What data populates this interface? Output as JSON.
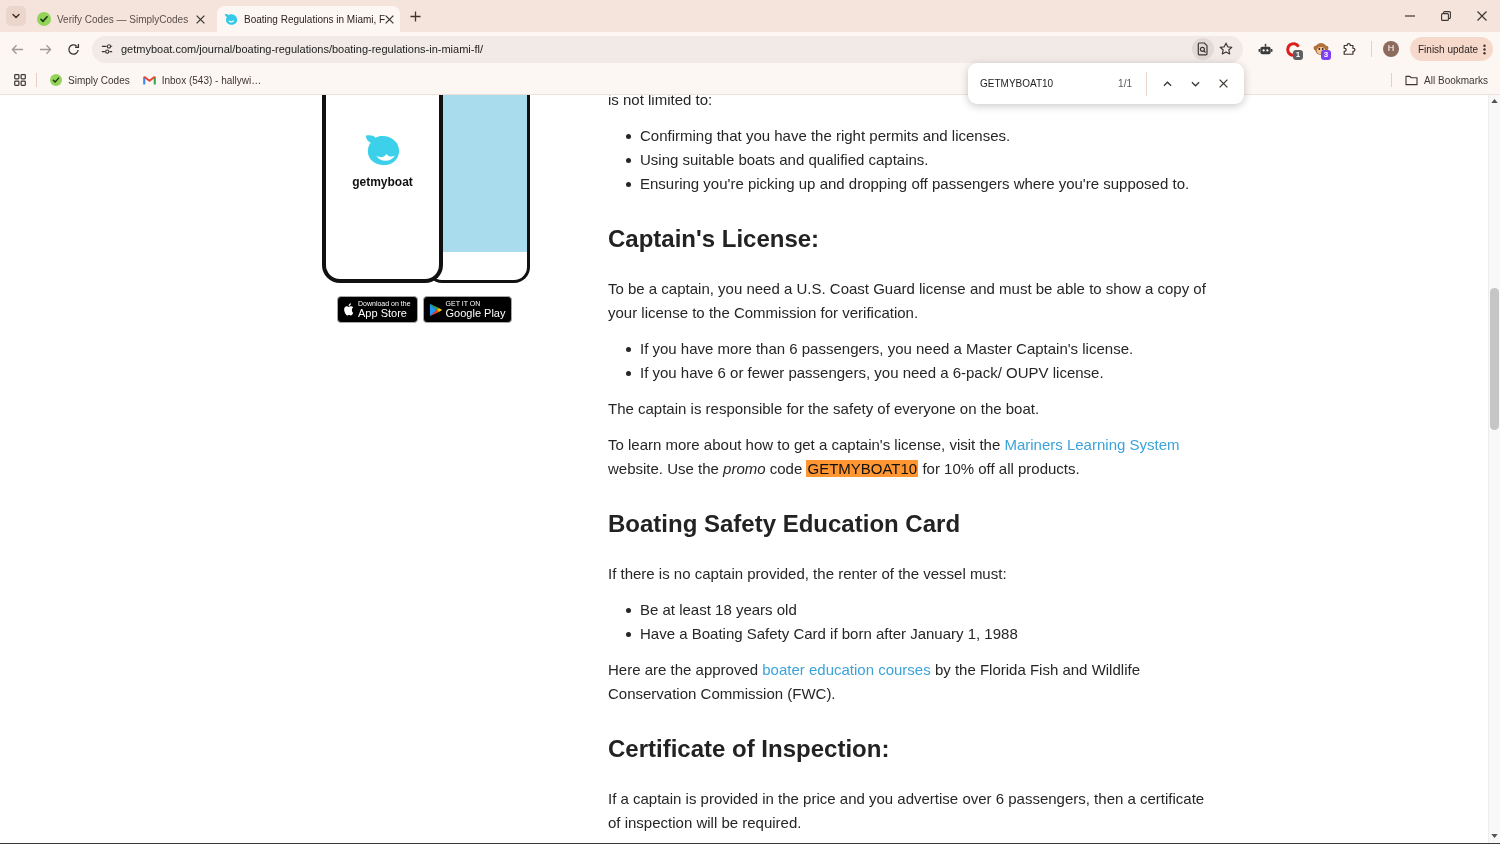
{
  "browser": {
    "tabs": [
      {
        "title": "Verify Codes — SimplyCodes",
        "selected": false
      },
      {
        "title": "Boating Regulations in Miami, F",
        "selected": true
      }
    ],
    "address": "getmyboat.com/journal/boating-regulations/boating-regulations-in-miami-fl/",
    "extension_badges": [
      {
        "count": "1",
        "color": "#5f5f5f"
      },
      {
        "count": "3",
        "color": "#7e3ff2"
      }
    ],
    "profile_initial": "H",
    "update_button": "Finish update",
    "bookmarks": [
      "Simply Codes",
      "Inbox (543) - hallywi…"
    ],
    "all_bookmarks": "All Bookmarks"
  },
  "find_bar": {
    "query": "GETMYBOAT10",
    "count": "1/1"
  },
  "app_promo": {
    "logo": "getmyboat",
    "stores": [
      {
        "line_1": "Download on the",
        "line_2": "App Store"
      },
      {
        "line_1": "GET IT ON",
        "line_2": "Google Play"
      }
    ]
  },
  "article": [
    {
      "kind": "paragraph",
      "parts": [
        {
          "kind": "text",
          "text": "is not limited to:"
        }
      ]
    },
    {
      "kind": "list",
      "items": [
        "Confirming that you have the right permits and licenses.",
        "Using suitable boats and qualified captains.",
        "Ensuring you're picking up and dropping off passengers where you're supposed to."
      ]
    },
    {
      "kind": "heading",
      "text": "Captain's License:"
    },
    {
      "kind": "paragraph",
      "parts": [
        {
          "kind": "text",
          "text": "To be a captain, you need a U.S. Coast Guard license and must be able to show a copy of your license to the Commission for verification."
        }
      ]
    },
    {
      "kind": "list",
      "items": [
        "If you have more than 6 passengers, you need a Master Captain's license.",
        "If you have 6 or fewer passengers, you need a 6-pack/ OUPV license."
      ]
    },
    {
      "kind": "paragraph",
      "parts": [
        {
          "kind": "text",
          "text": "The captain is responsible for the safety of everyone on the boat."
        }
      ]
    },
    {
      "kind": "paragraph",
      "parts": [
        {
          "kind": "text",
          "text": "To learn more about how to get a captain's license, visit the "
        },
        {
          "kind": "link",
          "text": "Mariners Learning System"
        },
        {
          "kind": "text",
          "text": " website. Use the *promo* code "
        },
        {
          "kind": "match",
          "text": "GETMYBOAT10"
        },
        {
          "kind": "text",
          "text": " for 10% off all products."
        }
      ]
    },
    {
      "kind": "heading",
      "text": "Boating Safety Education Card"
    },
    {
      "kind": "paragraph",
      "parts": [
        {
          "kind": "text",
          "text": "If there is no captain provided, the renter of the vessel must:"
        }
      ]
    },
    {
      "kind": "list",
      "items": [
        "Be at least 18 years old",
        "Have a Boating Safety Card if born after January 1, 1988"
      ]
    },
    {
      "kind": "paragraph",
      "parts": [
        {
          "kind": "text",
          "text": "Here are the approved "
        },
        {
          "kind": "link",
          "text": "boater education courses"
        },
        {
          "kind": "text",
          "text": " by the Florida Fish and Wildlife Conservation Commission (FWC)."
        }
      ]
    },
    {
      "kind": "heading",
      "text": "Certificate of Inspection:"
    },
    {
      "kind": "paragraph",
      "parts": [
        {
          "kind": "text",
          "text": "If a captain is provided in the price and you advertise over 6 passengers, then a certificate of inspection will be required."
        }
      ]
    }
  ]
}
